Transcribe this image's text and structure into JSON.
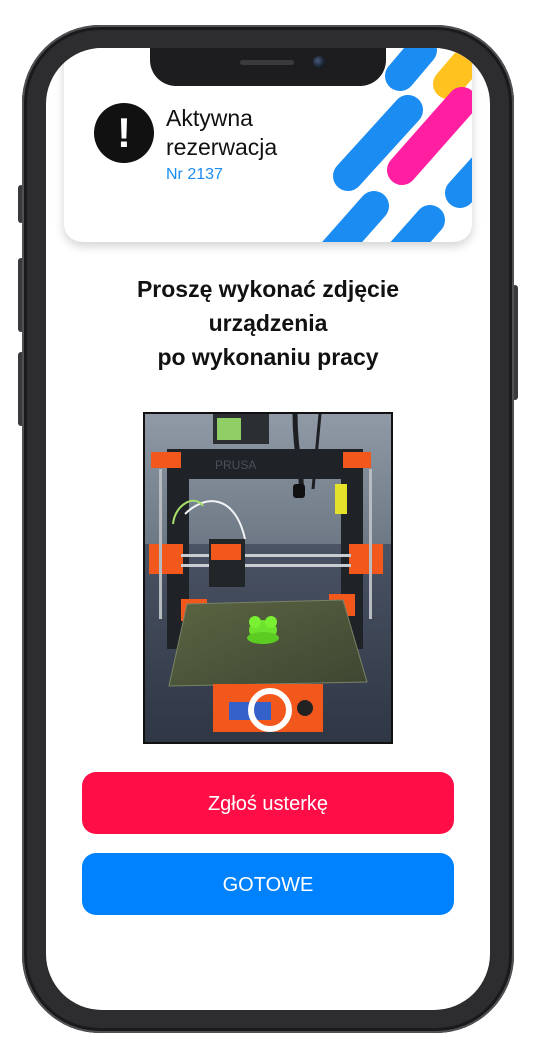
{
  "header": {
    "icon": "exclamation-icon",
    "title": "Aktywna rezerwacja",
    "reservation_number": "Nr 2137",
    "accent_colors": [
      "#1b8cf2",
      "#ff1fa0",
      "#ffc21f"
    ]
  },
  "instruction": {
    "lines": [
      "Proszę wykonać zdjęcie",
      "urządzenia",
      "po wykonaniu pracy"
    ]
  },
  "photo": {
    "subject": "3d-printer-photo",
    "shutter_icon": "camera-shutter-icon"
  },
  "buttons": {
    "report_label": "Zgłoś usterkę",
    "report_color": "#ff0d47",
    "done_label": "GOTOWE",
    "done_color": "#0082ff"
  }
}
